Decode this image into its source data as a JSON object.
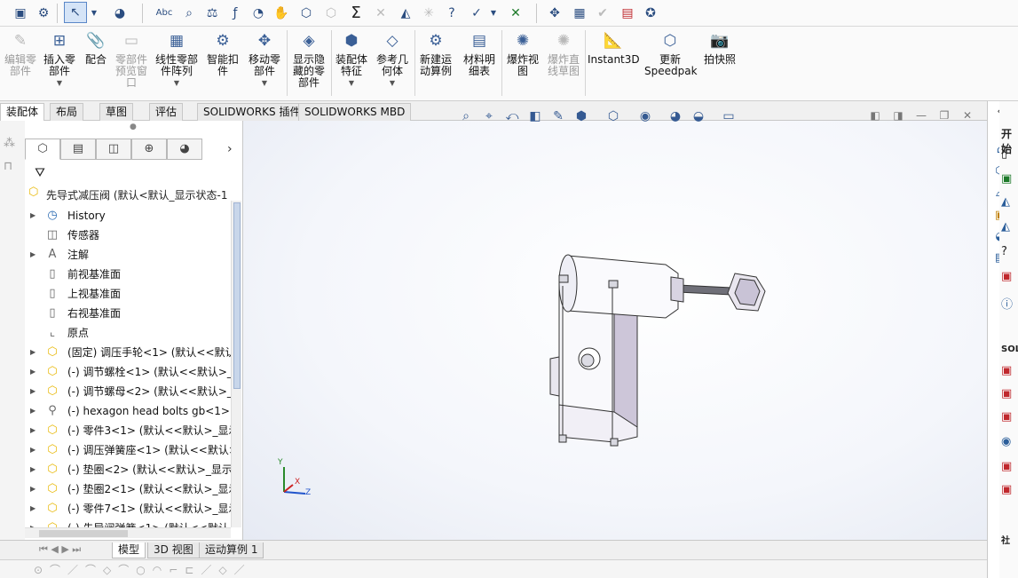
{
  "ribbon": {
    "items": [
      {
        "label": "编辑零部件",
        "disabled": true
      },
      {
        "label": "插入零部件",
        "disabled": false
      },
      {
        "label": "配合",
        "disabled": false
      },
      {
        "label": "零部件预览窗口",
        "disabled": true
      },
      {
        "label": "线性零部件阵列",
        "disabled": false
      },
      {
        "label": "智能扣件",
        "disabled": false
      },
      {
        "label": "移动零部件",
        "disabled": false
      },
      {
        "label": "显示隐藏的零部件",
        "disabled": false
      },
      {
        "label": "装配体特征",
        "disabled": false
      },
      {
        "label": "参考几何体",
        "disabled": false
      },
      {
        "label": "新建运动算例",
        "disabled": false
      },
      {
        "label": "材料明细表",
        "disabled": false
      },
      {
        "label": "爆炸视图",
        "disabled": false
      },
      {
        "label": "爆炸直线草图",
        "disabled": true
      },
      {
        "label": "Instant3D",
        "disabled": false
      },
      {
        "label": "更新Speedpak",
        "disabled": false
      },
      {
        "label": "拍快照",
        "disabled": false
      }
    ]
  },
  "cmd_tabs": [
    "装配体",
    "布局",
    "草图",
    "评估",
    "SOLIDWORKS 插件",
    "SOLIDWORKS MBD"
  ],
  "tree": {
    "root": "先导式减压阀 (默认<默认_显示状态-1",
    "items": [
      {
        "label": "History",
        "icon": "history-icon",
        "expandable": true
      },
      {
        "label": "传感器",
        "icon": "sensor-icon",
        "expandable": false
      },
      {
        "label": "注解",
        "icon": "annotation-icon",
        "expandable": true
      },
      {
        "label": "前视基准面",
        "icon": "plane-icon",
        "expandable": false
      },
      {
        "label": "上视基准面",
        "icon": "plane-icon",
        "expandable": false
      },
      {
        "label": "右视基准面",
        "icon": "plane-icon",
        "expandable": false
      },
      {
        "label": "原点",
        "icon": "origin-icon",
        "expandable": false
      },
      {
        "label": "(固定) 调压手轮<1> (默认<<默认_",
        "icon": "part-icon",
        "expandable": true
      },
      {
        "label": "(-) 调节螺栓<1> (默认<<默认>_显",
        "icon": "part-icon",
        "expandable": true
      },
      {
        "label": "(-) 调节螺母<2> (默认<<默认>_显",
        "icon": "part-icon",
        "expandable": true
      },
      {
        "label": "(-) hexagon head bolts gb<1>",
        "icon": "bolt-icon",
        "expandable": true
      },
      {
        "label": "(-) 零件3<1> (默认<<默认>_显示",
        "icon": "part-icon",
        "expandable": true
      },
      {
        "label": "(-) 调压弹簧座<1> (默认<<默认>",
        "icon": "part-icon",
        "expandable": true
      },
      {
        "label": "(-) 垫圈<2> (默认<<默认>_显示状",
        "icon": "part-icon",
        "expandable": true
      },
      {
        "label": "(-) 垫圈2<1> (默认<<默认>_显示",
        "icon": "part-icon",
        "expandable": true
      },
      {
        "label": "(-) 零件7<1> (默认<<默认>_显示",
        "icon": "part-icon",
        "expandable": true
      },
      {
        "label": "(-) 先导阀弹簧<1> (默认<<默认",
        "icon": "part-icon",
        "expandable": true
      }
    ]
  },
  "triad": {
    "x": "X",
    "y": "Y",
    "z": "Z"
  },
  "bottom_tabs": [
    "模型",
    "3D 视图",
    "运动算例 1"
  ],
  "task_pane": {
    "top_label": "开始",
    "mid_label": "SOL",
    "bottom_label": "社"
  },
  "colors": {
    "accent": "#2b5e9a",
    "part": "#e8b90a",
    "model_body": "#f7f7fb",
    "model_shade": "#c9c3d6"
  }
}
